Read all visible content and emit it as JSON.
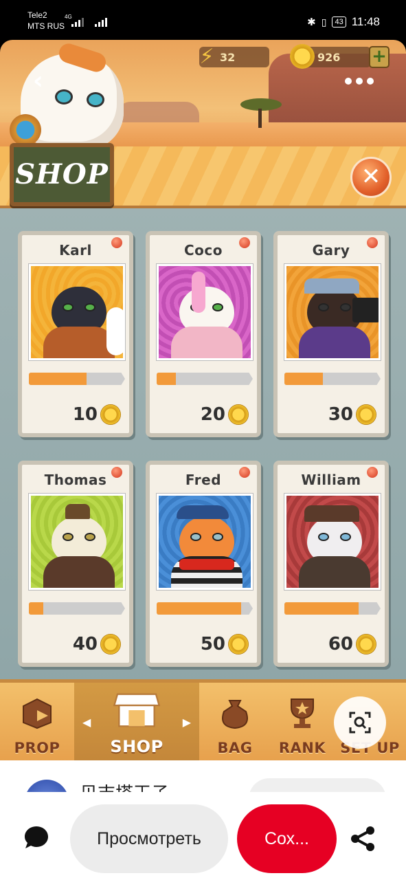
{
  "status_bar": {
    "carrier_1": "Tele2",
    "carrier_2": "MTS RUS",
    "network": "4G",
    "battery": "43",
    "time": "11:48"
  },
  "hud": {
    "energy": "32",
    "coins": "926",
    "add_label": "+"
  },
  "header": {
    "title": "SHOP",
    "close_label": "✕",
    "back_label": "‹"
  },
  "cards": [
    {
      "name": "Karl",
      "price": "10",
      "progress": 0.6
    },
    {
      "name": "Coco",
      "price": "20",
      "progress": 0.2
    },
    {
      "name": "Gary",
      "price": "30",
      "progress": 0.4
    },
    {
      "name": "Thomas",
      "price": "40",
      "progress": 0.15
    },
    {
      "name": "Fred",
      "price": "50",
      "progress": 0.88
    },
    {
      "name": "William",
      "price": "60",
      "progress": 0.77
    }
  ],
  "nav": {
    "prop": "PROP",
    "shop": "SHOP",
    "bag": "BAG",
    "rank": "RANK",
    "setup": "SET UP"
  },
  "sheet": {
    "author_name": "贝吉塔王子",
    "view_label": "Просмотреть",
    "save_label": "Сох..."
  },
  "colors": {
    "progress_fill": "#f29a3a",
    "save_button": "#e60023"
  }
}
